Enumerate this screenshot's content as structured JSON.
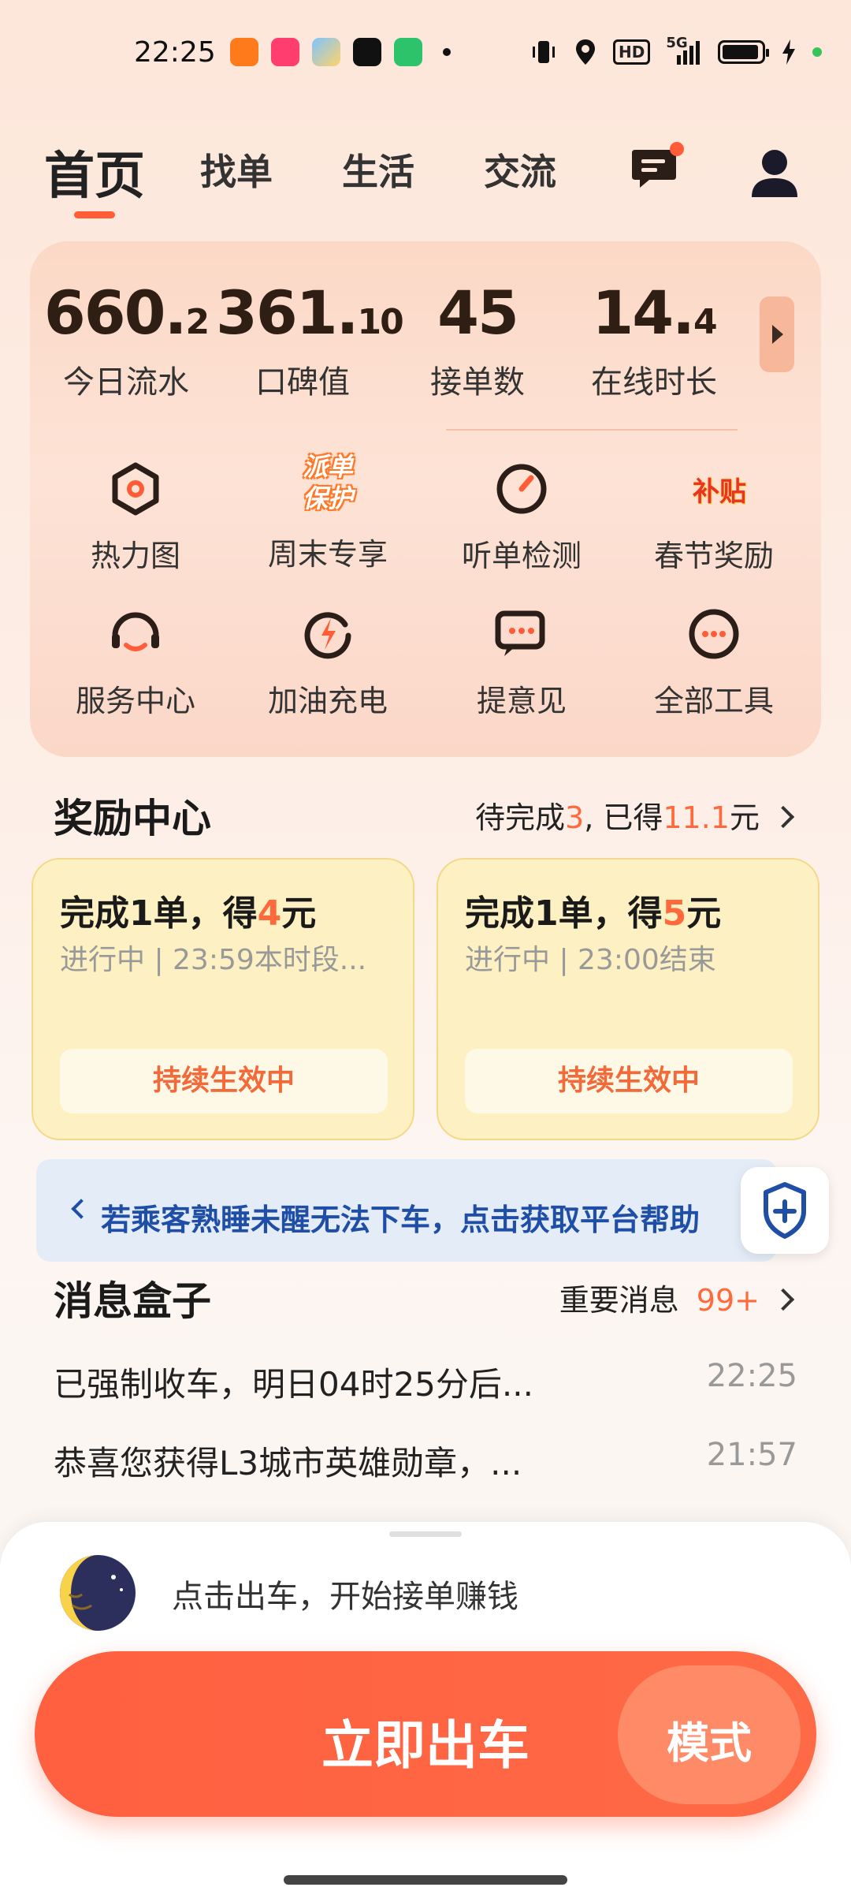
{
  "status_bar": {
    "time": "22:25",
    "app_icons": [
      "didi-icon",
      "health-icon",
      "weather-icon",
      "tiktok-icon",
      "shield-app-icon"
    ],
    "network": "5G",
    "hd": "HD"
  },
  "tabs": [
    {
      "label": "首页",
      "active": true
    },
    {
      "label": "找单",
      "active": false
    },
    {
      "label": "生活",
      "active": false
    },
    {
      "label": "交流",
      "active": false
    }
  ],
  "stats": [
    {
      "value_main": "660.",
      "value_small": "2",
      "label": "今日流水"
    },
    {
      "value_main": "361.",
      "value_small": "10",
      "label": "口碑值"
    },
    {
      "value_main": "45",
      "value_small": "",
      "label": "接单数"
    },
    {
      "value_main": "14.",
      "value_small": "4",
      "label": "在线时长"
    }
  ],
  "tools": [
    {
      "label": "热力图",
      "icon": "heatmap-icon"
    },
    {
      "label": "周末专享",
      "icon": "dispatch-protect-icon",
      "badge_line1": "派单",
      "badge_line2": "保护"
    },
    {
      "label": "听单检测",
      "icon": "gauge-icon"
    },
    {
      "label": "春节奖励",
      "icon": "subsidy-icon",
      "badge": "补贴"
    },
    {
      "label": "服务中心",
      "icon": "headset-icon"
    },
    {
      "label": "加油充电",
      "icon": "charge-icon"
    },
    {
      "label": "提意见",
      "icon": "feedback-icon"
    },
    {
      "label": "全部工具",
      "icon": "more-tools-icon"
    }
  ],
  "rewards": {
    "title": "奖励中心",
    "summary_prefix": "待完成",
    "pending": "3",
    "summary_mid": ", 已得",
    "earned": "11.1",
    "summary_suffix": "元",
    "cards": [
      {
        "title_prefix": "完成1单，得",
        "amount": "4",
        "title_suffix": "元",
        "sub": "进行中 | 23:59本时段...",
        "status": "持续生效中"
      },
      {
        "title_prefix": "完成1单，得",
        "amount": "5",
        "title_suffix": "元",
        "sub": "进行中 | 23:00结束",
        "status": "持续生效中"
      }
    ]
  },
  "help_banner": {
    "text": "若乘客熟睡未醒无法下车，点击获取平台帮助"
  },
  "messages": {
    "title": "消息盒子",
    "important_label": "重要消息",
    "important_count": "99+",
    "items": [
      {
        "text": "已强制收车，明日04时25分后...",
        "time": "22:25"
      },
      {
        "text": "恭喜您获得L3城市英雄勋章，...",
        "time": "21:57"
      }
    ]
  },
  "bottom": {
    "prompt": "点击出车，开始接单赚钱",
    "go_label": "立即出车",
    "mode_label": "模式"
  },
  "colors": {
    "accent": "#ff5c37",
    "help_blue": "#1f4ea6",
    "reward_bg": "#fdf1c3"
  }
}
